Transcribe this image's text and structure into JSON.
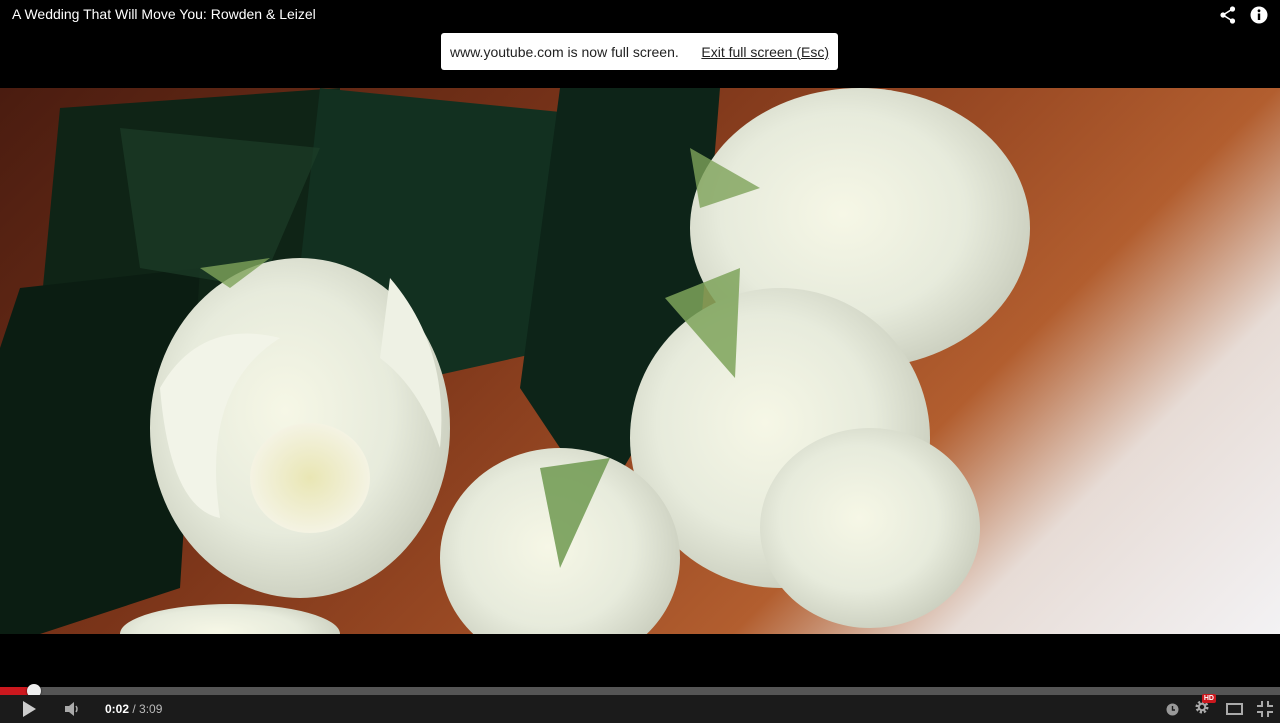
{
  "video": {
    "title": "A Wedding That Will Move You: Rowden & Leizel"
  },
  "fullscreen_notice": {
    "message": "www.youtube.com is now full screen.",
    "exit_label": "Exit full screen (Esc)"
  },
  "player": {
    "current_time": "0:02",
    "separator": "/",
    "duration": "3:09",
    "progress_fraction": 0.0106,
    "quality_badge": "HD",
    "accent_color": "#cc181e"
  },
  "icons": {
    "share": "share-icon",
    "info": "info-icon",
    "play": "play-icon",
    "volume": "volume-icon",
    "watch_later": "clock-icon",
    "settings": "gear-icon",
    "theater": "theater-mode-icon",
    "fullscreen_exit": "exit-fullscreen-icon"
  }
}
